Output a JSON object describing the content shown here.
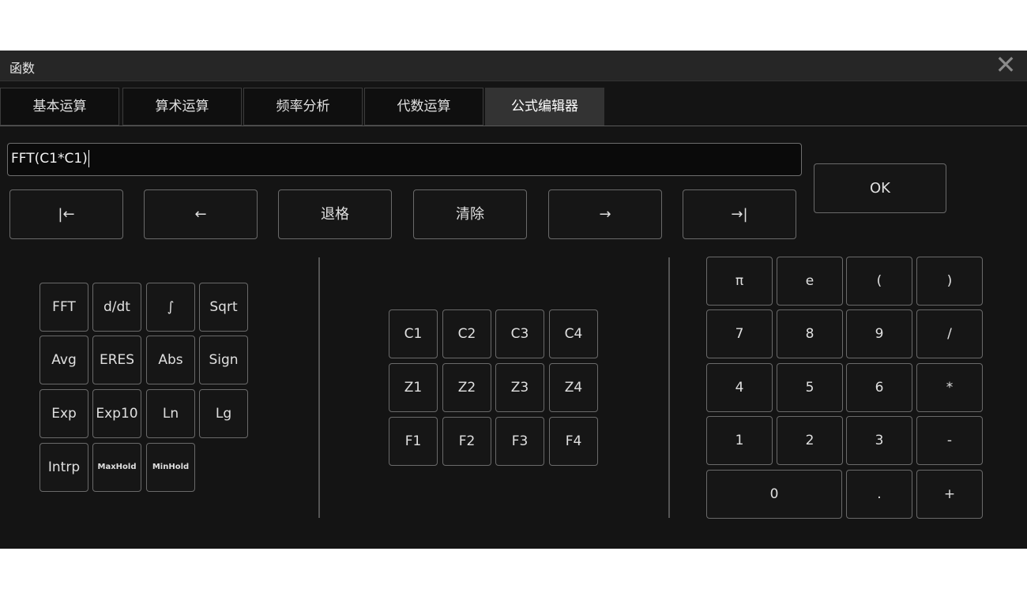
{
  "window": {
    "title": "函数",
    "close_glyph": "✕"
  },
  "tabs": [
    {
      "label": "基本运算"
    },
    {
      "label": "算术运算"
    },
    {
      "label": "频率分析"
    },
    {
      "label": "代数运算"
    },
    {
      "label": "公式编辑器",
      "active": true
    }
  ],
  "formula": {
    "value": "FFT(C1*C1)"
  },
  "nav_buttons": [
    {
      "label": "|←"
    },
    {
      "label": "←"
    },
    {
      "label": "退格"
    },
    {
      "label": "清除"
    },
    {
      "label": "→"
    },
    {
      "label": "→|"
    }
  ],
  "ok_label": "OK",
  "functions": [
    "FFT",
    "d/dt",
    "∫",
    "Sqrt",
    "Avg",
    "ERES",
    "Abs",
    "Sign",
    "Exp",
    "Exp10",
    "Ln",
    "Lg",
    "Intrp",
    "MaxHold",
    "MinHold"
  ],
  "sources": [
    "C1",
    "C2",
    "C3",
    "C4",
    "Z1",
    "Z2",
    "Z3",
    "Z4",
    "F1",
    "F2",
    "F3",
    "F4"
  ],
  "keypad": [
    "π",
    "e",
    "(",
    ")",
    "7",
    "8",
    "9",
    "/",
    "4",
    "5",
    "6",
    "*",
    "1",
    "2",
    "3",
    "-",
    "0",
    ".",
    "+"
  ]
}
